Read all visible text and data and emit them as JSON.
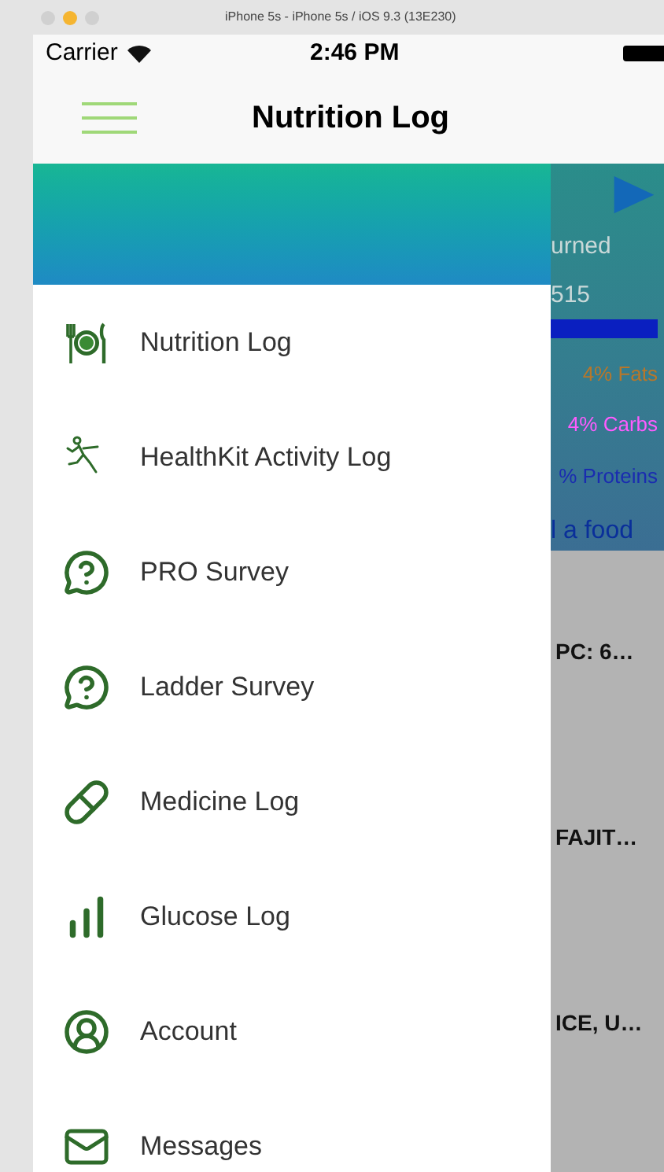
{
  "simulator_title": "iPhone 5s - iPhone 5s / iOS 9.3 (13E230)",
  "status_bar": {
    "carrier": "Carrier",
    "time": "2:46 PM"
  },
  "nav_bar": {
    "title": "Nutrition Log"
  },
  "drawer": {
    "items": [
      {
        "label": "Nutrition Log",
        "kind": "plate"
      },
      {
        "label": "HealthKit Activity Log",
        "kind": "runner"
      },
      {
        "label": "PRO Survey",
        "kind": "question"
      },
      {
        "label": "Ladder Survey",
        "kind": "question"
      },
      {
        "label": "Medicine Log",
        "kind": "pill"
      },
      {
        "label": "Glucose Log",
        "kind": "bars"
      },
      {
        "label": "Account",
        "kind": "account"
      },
      {
        "label": "Messages",
        "kind": "mail"
      }
    ]
  },
  "background": {
    "burned_label": "urned",
    "burned_value": "515",
    "macros": [
      {
        "label": "4% Fats",
        "color": "#b8772a"
      },
      {
        "label": "4% Carbs",
        "color": "#ff5cff"
      },
      {
        "label": "% Proteins",
        "color": "#1a2cb0"
      }
    ],
    "progress": {
      "level": 1
    },
    "add_food": "l a food",
    "foods": [
      "PC: 6…",
      "FAJIT…",
      "ICE, U…"
    ]
  }
}
